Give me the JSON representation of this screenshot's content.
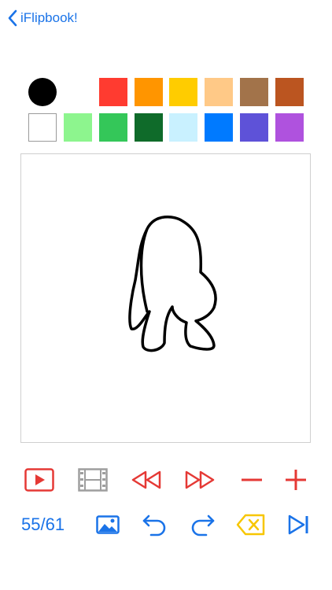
{
  "nav": {
    "back_label": "iFlipbook!"
  },
  "palette": {
    "selected_color": "#000000",
    "row1": [
      "#ff3b30",
      "#ff9500",
      "#ffcc00",
      "#ffc987",
      "#a2734a",
      "#bb5520"
    ],
    "row2": [
      "#ffffff",
      "#8df58e",
      "#34c759",
      "#0f6b2a",
      "#c9f1ff",
      "#007aff",
      "#5e52d8",
      "#af52de"
    ]
  },
  "toolbar": {
    "row1_icons": [
      "play-icon",
      "film-strip-icon",
      "rewind-icon",
      "fast-forward-icon",
      "minus-icon",
      "plus-icon"
    ],
    "row2_icons": [
      "image-icon",
      "undo-icon",
      "redo-icon",
      "delete-icon",
      "skip-to-end-icon"
    ]
  },
  "frame": {
    "current": 55,
    "total": 61,
    "label": "55/61"
  },
  "colors": {
    "accent_blue": "#1a73e8",
    "accent_red": "#e53935",
    "disabled_gray": "#9e9e9e",
    "delete_yellow": "#f7c600"
  }
}
